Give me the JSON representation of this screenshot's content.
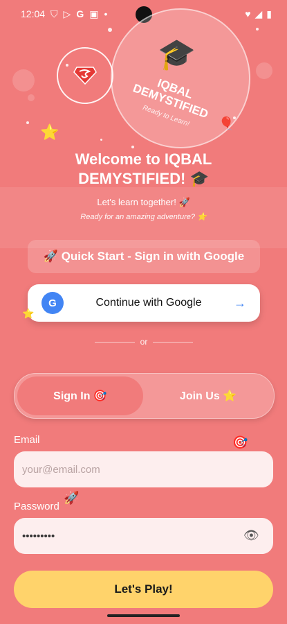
{
  "status_bar": {
    "time": "12:04",
    "left_icons": [
      "shield-icon",
      "play-store-icon",
      "google-icon",
      "notification-icon"
    ],
    "right_icons": [
      "heart-icon",
      "signal-icon",
      "battery-icon"
    ]
  },
  "brand": {
    "name": "IQBAL DEMYSTIFIED",
    "tagline": "Ready to Learn!",
    "logo": "superman-logo"
  },
  "hero": {
    "welcome": "Welcome to IQBAL DEMYSTIFIED! 🎓",
    "subtitle": "Let's learn together! 🚀",
    "tagline": "Ready for an amazing adventure? ⭐"
  },
  "actions": {
    "quick_start": "🚀 Quick Start - Sign in with Google",
    "google_continue": "Continue with Google",
    "google_letter": "G",
    "google_arrow": "→",
    "divider": "or"
  },
  "auth_toggle": {
    "sign_in": "Sign In 🎯",
    "join": "Join Us ⭐",
    "active": "sign_in"
  },
  "form": {
    "email_label": "Email",
    "email_placeholder": "your@email.com",
    "password_label": "Password",
    "password_value": "•••••••••",
    "submit": "Let's Play!"
  },
  "colors": {
    "background": "#f17b7b",
    "accent": "#ffd36b",
    "google_blue": "#4285f4"
  }
}
